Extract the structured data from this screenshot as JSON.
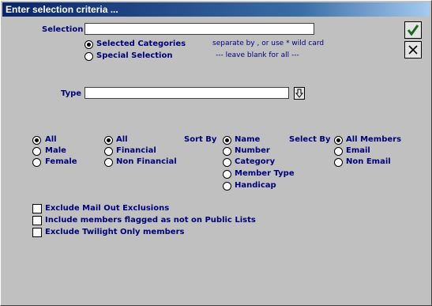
{
  "window": {
    "title": "Enter selection criteria ..."
  },
  "selection": {
    "label": "Selection",
    "value": "",
    "options": [
      "Selected Categories",
      "Special Selection"
    ],
    "selected_index": 0,
    "hint_line1": "separate by  , or use * wild card",
    "hint_line2": "---   leave blank for all   ---"
  },
  "type": {
    "label": "Type",
    "value": ""
  },
  "gender": {
    "options": [
      "All",
      "Male",
      "Female"
    ],
    "selected_index": 0
  },
  "financial": {
    "options": [
      "All",
      "Financial",
      "Non Financial"
    ],
    "selected_index": 0
  },
  "sort_by": {
    "label": "Sort By",
    "options": [
      "Name",
      "Number",
      "Category",
      "Member Type",
      "Handicap"
    ],
    "selected_index": 0
  },
  "select_by": {
    "label": "Select By",
    "options": [
      "All Members",
      "Email",
      "Non Email"
    ],
    "selected_index": 0
  },
  "checkboxes": [
    {
      "label": "Exclude Mail Out Exclusions",
      "checked": false
    },
    {
      "label": "Include members flagged as not on Public Lists",
      "checked": false
    },
    {
      "label": "Exclude Twilight Only members",
      "checked": false
    }
  ],
  "buttons": {
    "ok_icon": "check-icon",
    "cancel_icon": "close-icon",
    "type_dropdown_icon": "arrow-down-icon"
  },
  "colors": {
    "label": "#00007a",
    "background": "#c0c0c0",
    "ok_green": "#1a6a1a"
  }
}
